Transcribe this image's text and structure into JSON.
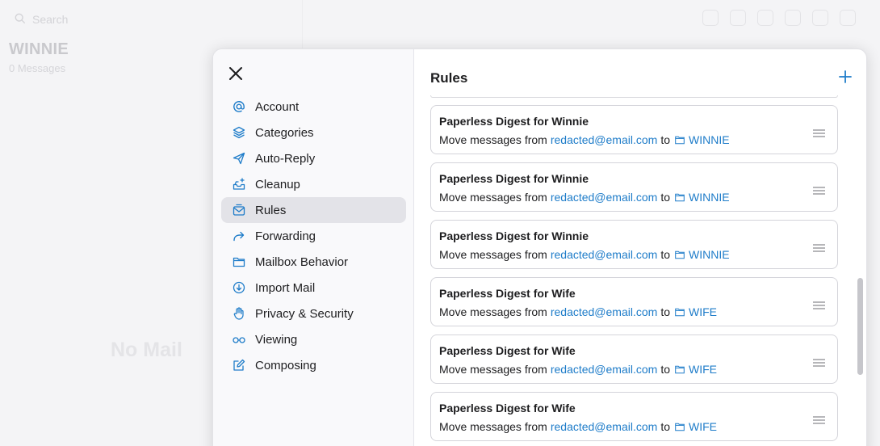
{
  "background": {
    "search_placeholder": "Search",
    "mailbox_title": "WINNIE",
    "mailbox_count": "0 Messages",
    "empty_text": "No Mail"
  },
  "sidebar": {
    "items": [
      {
        "label": "Account",
        "icon": "at-icon"
      },
      {
        "label": "Categories",
        "icon": "layers-icon"
      },
      {
        "label": "Auto-Reply",
        "icon": "paper-plane-icon"
      },
      {
        "label": "Cleanup",
        "icon": "tray-sparkle-icon"
      },
      {
        "label": "Rules",
        "icon": "envelope-rules-icon",
        "active": true
      },
      {
        "label": "Forwarding",
        "icon": "forward-arrow-icon"
      },
      {
        "label": "Mailbox Behavior",
        "icon": "folder-icon"
      },
      {
        "label": "Import Mail",
        "icon": "download-circle-icon"
      },
      {
        "label": "Privacy & Security",
        "icon": "hand-icon"
      },
      {
        "label": "Viewing",
        "icon": "glasses-icon"
      },
      {
        "label": "Composing",
        "icon": "compose-icon"
      }
    ]
  },
  "main": {
    "title": "Rules",
    "rules": [
      {
        "name": "Paperless Digest for Winnie",
        "prefix": "Move messages from",
        "email": "redacted@email.com",
        "joiner": "to",
        "folder": "WINNIE"
      },
      {
        "name": "Paperless Digest for Winnie",
        "prefix": "Move messages from",
        "email": "redacted@email.com",
        "joiner": "to",
        "folder": "WINNIE"
      },
      {
        "name": "Paperless Digest for Winnie",
        "prefix": "Move messages from",
        "email": "redacted@email.com",
        "joiner": "to",
        "folder": "WINNIE"
      },
      {
        "name": "Paperless Digest for Wife",
        "prefix": "Move messages from",
        "email": "redacted@email.com",
        "joiner": "to",
        "folder": "WIFE"
      },
      {
        "name": "Paperless Digest for Wife",
        "prefix": "Move messages from",
        "email": "redacted@email.com",
        "joiner": "to",
        "folder": "WIFE"
      },
      {
        "name": "Paperless Digest for Wife",
        "prefix": "Move messages from",
        "email": "redacted@email.com",
        "joiner": "to",
        "folder": "WIFE"
      }
    ]
  },
  "colors": {
    "accent": "#1e7cc9",
    "active_bg": "#e3e3e8"
  }
}
